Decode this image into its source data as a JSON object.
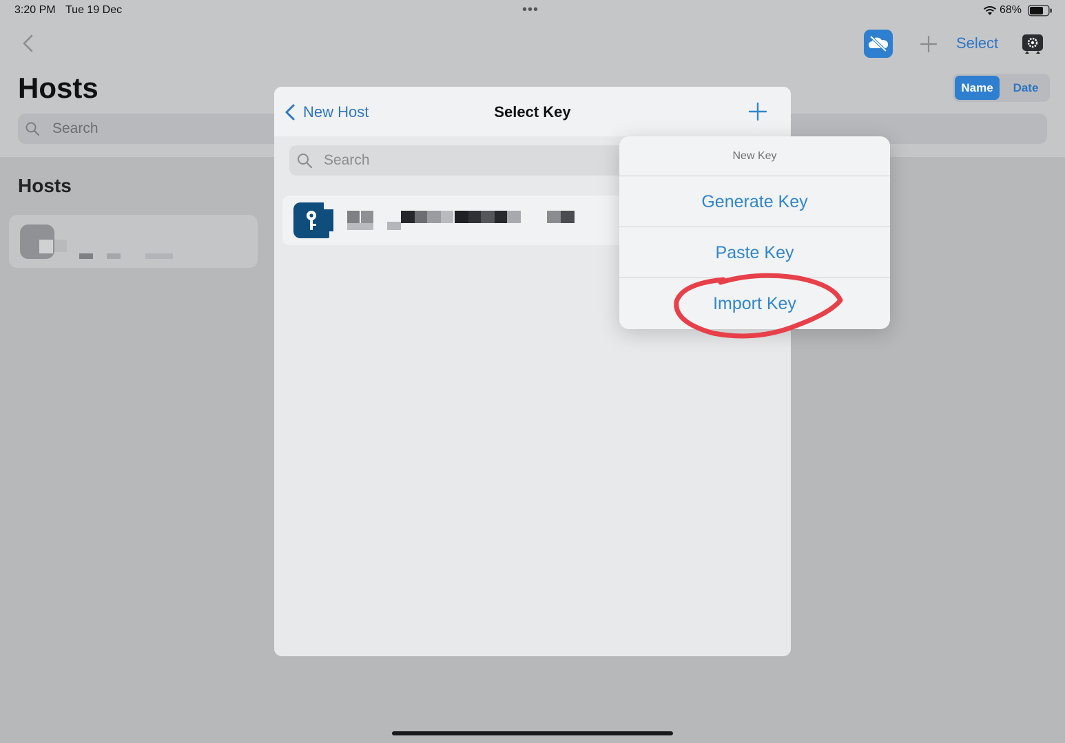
{
  "status_bar": {
    "time": "3:20 PM",
    "date": "Tue 19 Dec",
    "battery": "68%"
  },
  "toolbar": {
    "select_label": "Select"
  },
  "header": {
    "title": "Hosts"
  },
  "sort": {
    "name_label": "Name",
    "date_label": "Date"
  },
  "search": {
    "placeholder": "Search"
  },
  "sections": {
    "hosts_heading": "Hosts"
  },
  "modal": {
    "back_label": "New Host",
    "title": "Select Key",
    "search_placeholder": "Search"
  },
  "popover": {
    "header": "New Key",
    "items": [
      {
        "label": "Generate Key"
      },
      {
        "label": "Paste Key"
      },
      {
        "label": "Import Key"
      }
    ]
  },
  "colors": {
    "accent": "#2f76c4",
    "annotation": "#e8404a",
    "key_icon": "#0e4d7c"
  },
  "icons": [
    "back-chevron-icon",
    "cloud-off-icon",
    "plus-icon",
    "settings-icon",
    "search-icon",
    "key-icon",
    "wifi-icon",
    "battery-icon"
  ]
}
